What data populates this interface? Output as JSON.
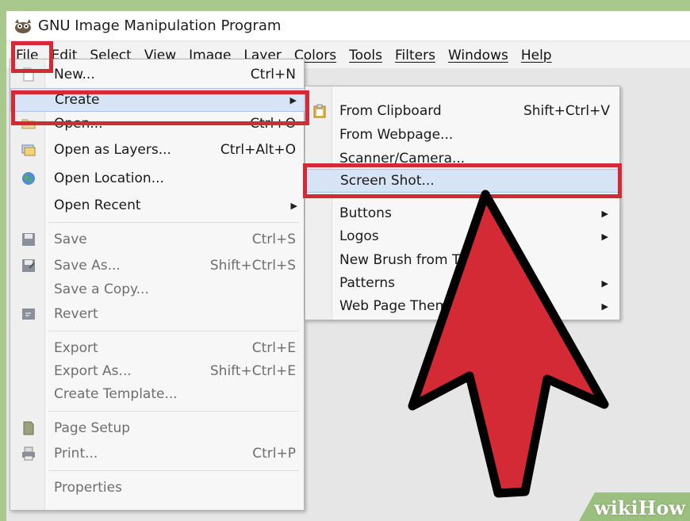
{
  "window": {
    "title": "GNU Image Manipulation Program",
    "app_icon": "gimp-wilber-icon"
  },
  "menubar": [
    {
      "label": "File"
    },
    {
      "label": "Edit"
    },
    {
      "label": "Select"
    },
    {
      "label": "View"
    },
    {
      "label": "Image"
    },
    {
      "label": "Layer"
    },
    {
      "label": "Colors"
    },
    {
      "label": "Tools"
    },
    {
      "label": "Filters"
    },
    {
      "label": "Windows"
    },
    {
      "label": "Help"
    }
  ],
  "file_menu": {
    "items": [
      {
        "label": "New...",
        "shortcut": "Ctrl+N",
        "icon": "new-file-icon"
      },
      {
        "label": "Create",
        "shortcut": "",
        "submenu": true
      },
      {
        "label": "Open...",
        "shortcut": "Ctrl+O",
        "icon": "open-folder-icon"
      },
      {
        "label": "Open as Layers...",
        "shortcut": "Ctrl+Alt+O",
        "icon": "open-layers-icon"
      },
      {
        "label": "Open Location...",
        "shortcut": "",
        "icon": "globe-icon"
      },
      {
        "label": "Open Recent",
        "shortcut": "",
        "submenu": true
      },
      {
        "label": "Save",
        "shortcut": "Ctrl+S",
        "icon": "save-icon",
        "disabled": true
      },
      {
        "label": "Save As...",
        "shortcut": "Shift+Ctrl+S",
        "icon": "save-as-icon",
        "disabled": true
      },
      {
        "label": "Save a Copy...",
        "shortcut": "",
        "disabled": true
      },
      {
        "label": "Revert",
        "shortcut": "",
        "icon": "revert-icon",
        "disabled": true
      },
      {
        "label": "Export",
        "shortcut": "Ctrl+E",
        "disabled": true
      },
      {
        "label": "Export As...",
        "shortcut": "Shift+Ctrl+E",
        "disabled": true
      },
      {
        "label": "Create Template...",
        "shortcut": "",
        "disabled": true
      },
      {
        "label": "Page Setup",
        "shortcut": "",
        "icon": "page-setup-icon",
        "disabled": true
      },
      {
        "label": "Print...",
        "shortcut": "Ctrl+P",
        "icon": "print-icon",
        "disabled": true
      },
      {
        "label": "Properties",
        "shortcut": "",
        "disabled": true
      }
    ]
  },
  "create_submenu": {
    "items": [
      {
        "label": "From Clipboard",
        "shortcut": "Shift+Ctrl+V",
        "icon": "clipboard-icon"
      },
      {
        "label": "From Webpage...",
        "shortcut": ""
      },
      {
        "label": "Scanner/Camera...",
        "shortcut": ""
      },
      {
        "label": "Screen Shot...",
        "shortcut": ""
      },
      {
        "label": "Buttons",
        "submenu": true
      },
      {
        "label": "Logos",
        "submenu": true
      },
      {
        "label": "New Brush from Te",
        "shortcut": ""
      },
      {
        "label": "Patterns",
        "submenu": true
      },
      {
        "label": "Web Page Them",
        "submenu": true
      }
    ]
  },
  "submenu_arrow": "▶",
  "watermark": {
    "text": "wikiHow"
  },
  "colors": {
    "highlight_box": "#d42a36",
    "pointer_arrow": "#d42a36",
    "hover": "#d6e4f5"
  }
}
